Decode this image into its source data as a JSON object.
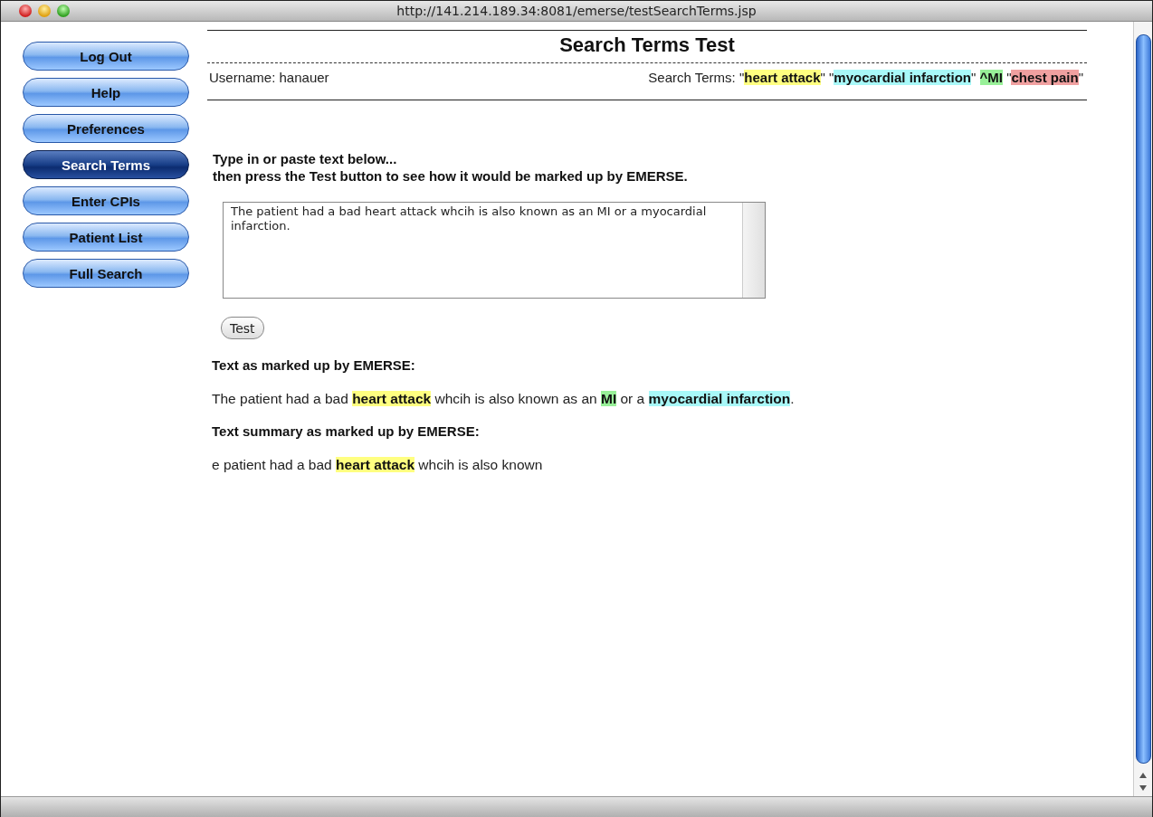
{
  "window": {
    "title": "http://141.214.189.34:8081/emerse/testSearchTerms.jsp"
  },
  "sidebar": {
    "items": [
      {
        "label": "Log Out",
        "selected": false
      },
      {
        "label": "Help",
        "selected": false
      },
      {
        "label": "Preferences",
        "selected": false
      },
      {
        "label": "Search Terms",
        "selected": true
      },
      {
        "label": "Enter CPIs",
        "selected": false
      },
      {
        "label": "Patient List",
        "selected": false
      },
      {
        "label": "Full Search",
        "selected": false
      }
    ]
  },
  "header": {
    "title": "Search Terms Test",
    "username": "Username: hanauer",
    "search_terms_label": "Search Terms:",
    "search_terms": [
      {
        "text": " \""
      },
      {
        "text": "heart attack",
        "color": "#ffff80"
      },
      {
        "text": "\" \""
      },
      {
        "text": "myocardial infarction",
        "color": "#a8f8f8"
      },
      {
        "text": "\" "
      },
      {
        "text": "^MI",
        "color": "#98f098"
      },
      {
        "text": " \""
      },
      {
        "text": "chest pain",
        "color": "#f0a0a0"
      },
      {
        "text": "\""
      }
    ]
  },
  "instructions": [
    "Type in or paste text below...",
    "then press the Test button to see how it would be marked up by EMERSE."
  ],
  "input": {
    "value": "The patient had a bad heart attack whcih is also known as an MI or a myocardial infarction."
  },
  "test_button": "Test",
  "results": [
    {
      "heading": "Text as marked up by EMERSE:",
      "segments": [
        {
          "text": "The patient had a bad "
        },
        {
          "text": "heart attack",
          "color": "#ffff80"
        },
        {
          "text": " whcih is also known as an "
        },
        {
          "text": "MI",
          "color": "#98f098"
        },
        {
          "text": " or a "
        },
        {
          "text": "myocardial infarction",
          "color": "#a8f8f8"
        },
        {
          "text": "."
        }
      ]
    },
    {
      "heading": "Text summary as marked up by EMERSE:",
      "segments": [
        {
          "text": "e patient had a bad "
        },
        {
          "text": "heart attack",
          "color": "#ffff80"
        },
        {
          "text": " whcih is also known"
        }
      ]
    }
  ]
}
